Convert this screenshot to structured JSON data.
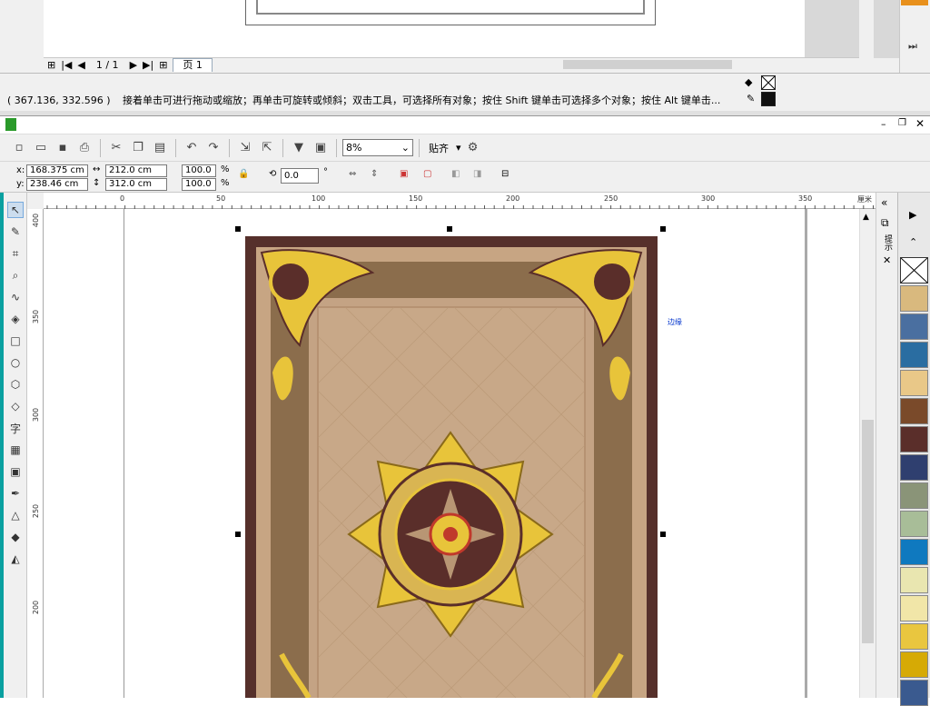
{
  "top_window": {
    "pager": {
      "current": "1 / 1",
      "page_tab": "页 1"
    }
  },
  "statusbar": {
    "coords": "( 367.136, 332.596 )",
    "message": "接着单击可进行拖动或缩放；再单击可旋转或倾斜；双击工具，可选择所有对象；按住 Shift 键单击可选择多个对象；按住 Alt 键单击..."
  },
  "toolbar": {
    "zoom_value": "8%",
    "snap_label": "贴齐"
  },
  "property_bar": {
    "x_label": "x:",
    "x_value": "168.375 cm",
    "y_label": "y:",
    "y_value": "238.46 cm",
    "width_value": "212.0 cm",
    "height_value": "312.0 cm",
    "scale_x": "100.0",
    "scale_y": "100.0",
    "percent": "%",
    "rotation": "0.0",
    "degree": "°"
  },
  "rulers": {
    "h_ticks": [
      "0",
      "50",
      "100",
      "150",
      "200",
      "250",
      "300",
      "350"
    ],
    "h_unit": "厘米",
    "v_ticks": [
      "400",
      "350",
      "300",
      "250",
      "200"
    ]
  },
  "canvas": {
    "object_label": "边缘"
  },
  "dockers": {
    "panel_label": "提示"
  },
  "palette": {
    "colors": [
      "#d9b97e",
      "#4a6fa0",
      "#2a6da1",
      "#e9c888",
      "#7a4a2a",
      "#5a2e2a",
      "#2f3f6f",
      "#8a9478",
      "#a8bd98",
      "#0f79bf",
      "#e9e6b0",
      "#f1e6a8",
      "#e9c63f",
      "#d6aa05",
      "#3a5a8f"
    ]
  },
  "colors": {
    "rug_outer": "#56302b",
    "rug_border": "#8b6d4c",
    "rug_field": "#c4a384",
    "gold": "#e8c43a"
  }
}
